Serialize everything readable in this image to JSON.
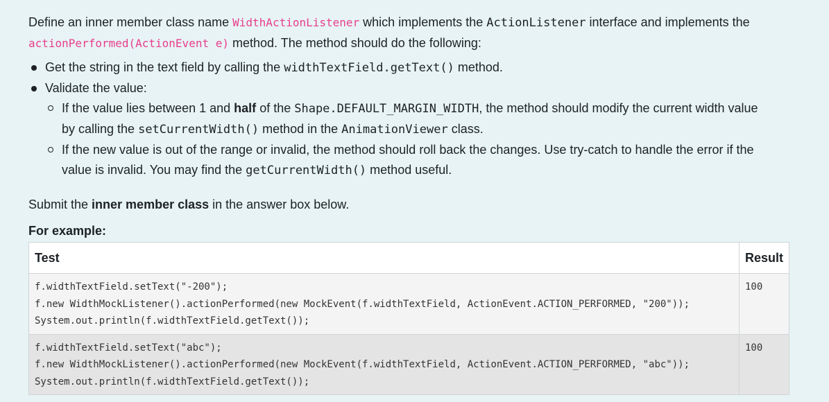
{
  "intro": {
    "t1": "Define an inner member class name ",
    "class_name": "WidthActionListener",
    "t2": " which implements the ",
    "interface_name": "ActionListener",
    "t3": " interface and implements the",
    "method_sig": "actionPerformed(ActionEvent e)",
    "t4": " method. The method should do the following:"
  },
  "bullets": {
    "b1_pre": "Get the string in the text field by calling the ",
    "b1_code": "widthTextField.getText()",
    "b1_post": " method.",
    "b2": "Validate the value:",
    "s1_pre": "If the value lies between 1 and ",
    "s1_bold": "half",
    "s1_mid": " of the ",
    "s1_code1": "Shape.DEFAULT_MARGIN_WIDTH",
    "s1_post": ", the method should modify the current width value",
    "s1_line2_pre": "by calling the ",
    "s1_code2": "setCurrentWidth()",
    "s1_line2_mid": " method in the ",
    "s1_code3": "AnimationViewer",
    "s1_line2_post": " class.",
    "s2_pre": "If the new value is out of the range or invalid, the method should roll back the changes. Use try-catch to handle the error if the",
    "s2_line2_pre": "value is invalid. You may find the ",
    "s2_code": "getCurrentWidth()",
    "s2_line2_post": " method useful."
  },
  "submit": {
    "pre": "Submit the ",
    "bold": "inner member class",
    "post": " in the answer box below."
  },
  "for_example": "For example:",
  "table": {
    "headers": [
      "Test",
      "Result"
    ],
    "rows": [
      {
        "test": "f.widthTextField.setText(\"-200\");\nf.new WidthMockListener().actionPerformed(new MockEvent(f.widthTextField, ActionEvent.ACTION_PERFORMED, \"200\"));\nSystem.out.println(f.widthTextField.getText());",
        "result": "100"
      },
      {
        "test": "f.widthTextField.setText(\"abc\");\nf.new WidthMockListener().actionPerformed(new MockEvent(f.widthTextField, ActionEvent.ACTION_PERFORMED, \"abc\"));\nSystem.out.println(f.widthTextField.getText());",
        "result": "100"
      }
    ]
  }
}
